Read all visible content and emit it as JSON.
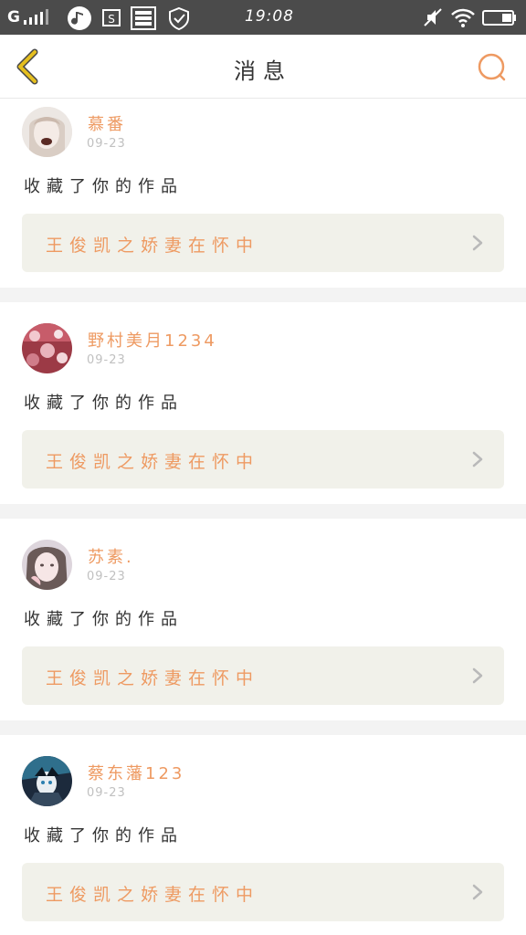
{
  "status_bar": {
    "carrier": "G",
    "time": "19:08"
  },
  "header": {
    "title": "消息",
    "back_icon": "chevron-left-icon",
    "search_icon": "search-icon"
  },
  "colors": {
    "accent": "#ee9a62",
    "back_icon": "#e5bf1f",
    "card_bg": "#f1f1ea",
    "separator": "#f3f3f3",
    "status_bar_bg": "#4b4b4b"
  },
  "notifications": [
    {
      "username": "慕番",
      "date": "09-23",
      "action": "收藏了你的作品",
      "work_title": "王俊凯之娇妻在怀中"
    },
    {
      "username": "野村美月1234",
      "date": "09-23",
      "action": "收藏了你的作品",
      "work_title": "王俊凯之娇妻在怀中"
    },
    {
      "username": "苏素.",
      "date": "09-23",
      "action": "收藏了你的作品",
      "work_title": "王俊凯之娇妻在怀中"
    },
    {
      "username": "蔡东藩123",
      "date": "09-23",
      "action": "收藏了你的作品",
      "work_title": "王俊凯之娇妻在怀中"
    }
  ]
}
